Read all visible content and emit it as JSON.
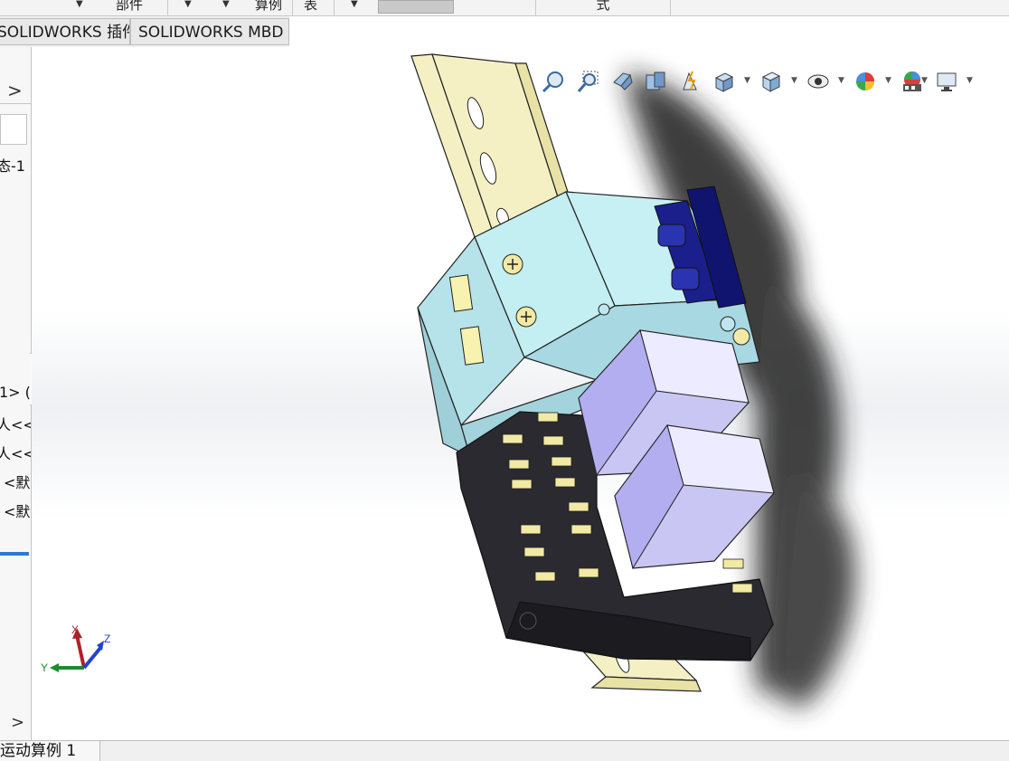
{
  "command_strip": {
    "items": [
      "部件",
      "算例",
      "表",
      "式"
    ]
  },
  "tabs": [
    {
      "label": "SOLIDWORKS 插件"
    },
    {
      "label": "SOLIDWORKS MBD"
    }
  ],
  "feature_tree": {
    "expand_glyph": ">",
    "rows": [
      "态-1",
      "1> (",
      "人<<",
      "人<<",
      "<默",
      "<默"
    ],
    "bottom_chevron": ">"
  },
  "heads_up_toolbar": {
    "icons": [
      "zoom-to-fit-icon",
      "zoom-to-area-icon",
      "previous-view-icon",
      "section-view-icon",
      "dynamic-annotation-icon",
      "view-orientation-icon",
      "display-style-icon",
      "hide-show-items-icon",
      "edit-appearance-icon",
      "apply-scene-icon",
      "view-settings-icon"
    ]
  },
  "triad": {
    "x": "X",
    "y": "Y",
    "z": "Z",
    "colors": {
      "x": "#b0202a",
      "y": "#1f8c2a",
      "z": "#2443c9"
    }
  },
  "bottom_tabs": [
    {
      "label": "运动算例 1"
    }
  ],
  "colors": {
    "din_rail": "#f4f0c4",
    "breaker_body": "#bfe6ee",
    "breaker_lever": "#1a1f8c",
    "relay_cover": "#c9c6f4",
    "terminal_base": "#2a2a30",
    "terminal_screw": "#f2eaa4"
  }
}
